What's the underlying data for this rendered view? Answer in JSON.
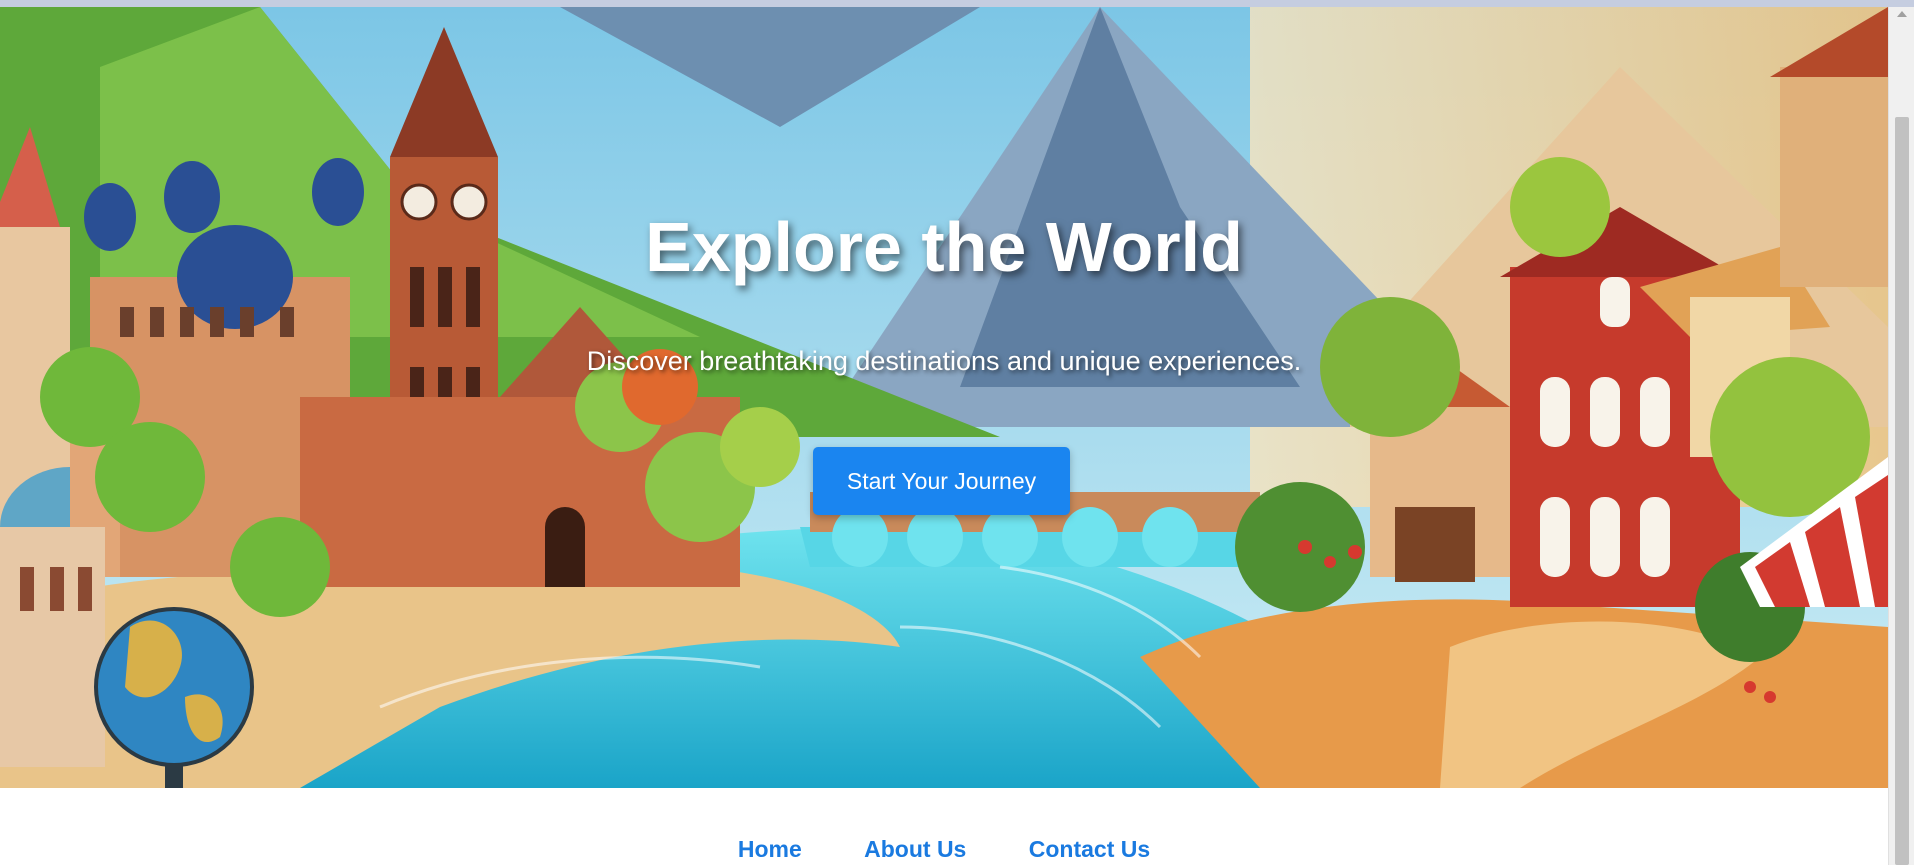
{
  "hero": {
    "title": "Explore the World",
    "subtitle": "Discover breathtaking destinations and unique experiences.",
    "cta_label": "Start Your Journey",
    "background_description_icon": "scenic-travel-illustration"
  },
  "nav": {
    "items": [
      {
        "label": "Home"
      },
      {
        "label": "About Us"
      },
      {
        "label": "Contact Us"
      }
    ]
  },
  "colors": {
    "accent": "#1a85f0",
    "nav_link": "#1a7ae0",
    "hero_text": "#ffffff"
  }
}
